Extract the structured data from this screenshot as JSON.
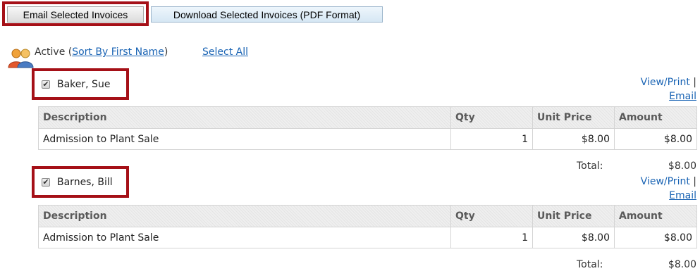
{
  "toolbar": {
    "email_label": "Email Selected Invoices",
    "download_label": "Download Selected Invoices (PDF Format)"
  },
  "list": {
    "icon": "users-icon",
    "status_label": "Active (",
    "sort_link": "Sort By First Name",
    "status_close": ")",
    "select_all": "Select All"
  },
  "table_headers": {
    "description": "Description",
    "qty": "Qty",
    "unit_price": "Unit Price",
    "amount": "Amount"
  },
  "members": [
    {
      "name": "Baker, Sue",
      "checked": true,
      "view_print": "View/Print",
      "separator": "|",
      "email_link": "Email",
      "rows": [
        {
          "description": "Admission to Plant Sale",
          "qty": "1",
          "unit_price": "$8.00",
          "amount": "$8.00"
        }
      ],
      "total_label": "Total:",
      "total_value": "$8.00"
    },
    {
      "name": "Barnes, Bill",
      "checked": true,
      "view_print": "View/Print",
      "separator": "|",
      "email_link": "Email",
      "rows": [
        {
          "description": "Admission to Plant Sale",
          "qty": "1",
          "unit_price": "$8.00",
          "amount": "$8.00"
        }
      ],
      "total_label": "Total:",
      "total_value": "$8.00"
    }
  ],
  "colors": {
    "highlight": "#a51017",
    "link": "#1a64b4",
    "header_bg": "#ececec"
  }
}
